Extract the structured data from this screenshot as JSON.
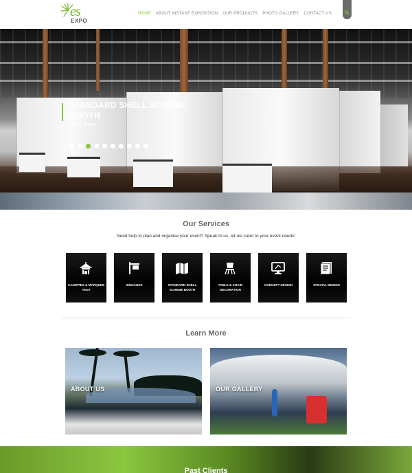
{
  "logo": {
    "text": "es",
    "subtext": "EXPO"
  },
  "nav": [
    {
      "label": "HOME",
      "active": true
    },
    {
      "label": "ABOUT INSTANT EXPOSITION",
      "active": false
    },
    {
      "label": "OUR PRODUCTS",
      "active": false
    },
    {
      "label": "PHOTO GALLERY",
      "active": false
    },
    {
      "label": "CONTACT US",
      "active": false
    }
  ],
  "search": {
    "icon": "search-icon"
  },
  "hero": {
    "title": "STANDARD SHELL SCHEME BOOTH",
    "view_more": "VIEW MORE →",
    "slide_count": 10,
    "active_slide": 3
  },
  "services": {
    "title": "Our Services",
    "subtitle": "Need help to plan and organise your event? Speak to us, let ust cater to your event needs!",
    "items": [
      {
        "label": "CANOPIES & MARQUEE TENT",
        "icon": "tent-icon"
      },
      {
        "label": "SIGNAGES",
        "icon": "signboard-icon"
      },
      {
        "label": "STANDARD SHELL SCHEME BOOTH",
        "icon": "map-icon"
      },
      {
        "label": "TABLE & CHAIR DECORATION",
        "icon": "chair-icon"
      },
      {
        "label": "CONCEPT DESIGN",
        "icon": "monitor-icon"
      },
      {
        "label": "SPECIAL DESIGN",
        "icon": "document-icon"
      }
    ]
  },
  "learn_more": {
    "title": "Learn More",
    "about": "ABOUT US",
    "gallery": "OUR GALLERY"
  },
  "clients": {
    "title": "Past Clients"
  },
  "colors": {
    "accent": "#8cc63f",
    "dark": "#000000"
  }
}
